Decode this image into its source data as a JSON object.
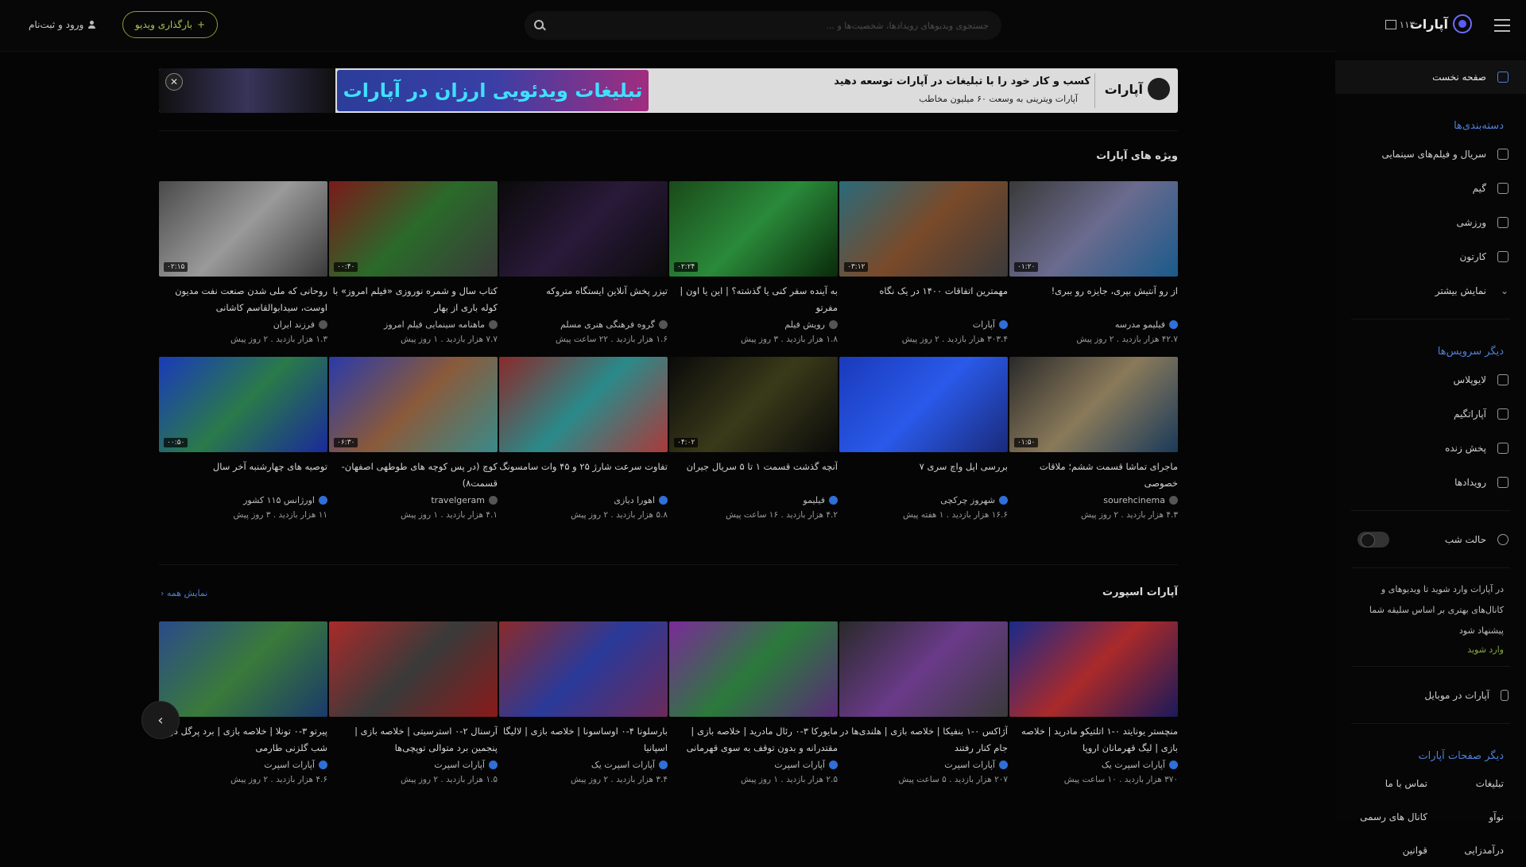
{
  "header": {
    "logo_text": "آپارات",
    "version_label": "۱۱۳",
    "search_placeholder": "جستجوی ویدیوهای رویدادها، شخصیت‌ها و ...",
    "upload_label": "بارگذاری ویدیو",
    "login_label": "ورود و ثبت‌نام"
  },
  "banner": {
    "headline": "کسب و کار خود را با تبلیغات در آپارات توسعه دهید",
    "subline": "آپارات ویترینی به وسعت ۶۰ میلیون مخاطب",
    "art_text": "تبلیغات ویدئویی ارزان در آپارات",
    "logo_text": "آپارات"
  },
  "sidebar": {
    "home": "صفحه نخست",
    "categories_title": "دسته‌بندی‌ها",
    "categories": [
      "سریال و فیلم‌های سینمایی",
      "گیم",
      "ورزشی",
      "کارتون",
      "نمایش بیشتر"
    ],
    "services_title": "دیگر سرویس‌ها",
    "services": [
      "لایوپلاس",
      "آپاراتگیم",
      "پخش زنده",
      "رویدادها"
    ],
    "night_mode": "حالت شب",
    "note": "در آپارات وارد شوید تا ویدیوهای و کانال‌های بهتری بر اساس سلیقه شما پیشنهاد شود",
    "login_link": "وارد شوید",
    "mobile": "آپارات در موبایل",
    "pages_title": "دیگر صفحات آپارات",
    "pages": [
      "تبلیغات",
      "تماس با ما",
      "نوآو",
      "کانال های رسمی",
      "درآمدزایی",
      "قوانین"
    ]
  },
  "featured": {
    "title": "ویژه های آپارات",
    "videos": [
      {
        "title": "از رو آنتیش بپری، جایزه رو ببری!",
        "channel": "فیلیمو مدرسه",
        "views": "۴۲.۷ هزار بازدید",
        "time": "۲ روز پیش",
        "dur": "۰۱:۲۰",
        "verified": true,
        "bg": "linear-gradient(135deg,#3a3a3a,#6b6b8f,#1a5a8a)"
      },
      {
        "title": "مهمترین اتفاقات ۱۴۰۰ در یک نگاه",
        "channel": "آپارات",
        "views": "۳۰۳.۴ هزار بازدید",
        "time": "۲ روز پیش",
        "dur": "۰۳:۱۲",
        "verified": true,
        "bg": "linear-gradient(135deg,#2a6a7a,#7a4a2a,#3a3a3a)"
      },
      {
        "title": "به آینده سفر کنی یا گذشته؟ | این یا اون | مفرتو",
        "channel": "رویش فیلم",
        "views": "۱.۸ هزار بازدید",
        "time": "۳ روز پیش",
        "dur": "۰۲:۲۴",
        "verified": false,
        "bg": "linear-gradient(135deg,#1a4a1a,#2a8a3a,#0a2a0a)"
      },
      {
        "title": "تیزر پخش آنلاین ایستگاه متروکه",
        "channel": "گروه فرهنگی هنری مسلم",
        "views": "۱.۶ هزار بازدید",
        "time": "۲۲ ساعت پیش",
        "dur": "",
        "verified": false,
        "bg": "linear-gradient(135deg,#0a0a0a,#2a1a3a,#0a0a0a)"
      },
      {
        "title": "کتاب سال و شمره نوروزی «فیلم امروز» با کوله باری از بهار",
        "channel": "ماهنامه سینمایی فیلم امروز",
        "views": "۷.۷ هزار بازدید",
        "time": "۱ روز پیش",
        "dur": "۰۰:۴۰",
        "verified": false,
        "bg": "linear-gradient(135deg,#7a1a1a,#2a6a2a,#3a3a3a)"
      },
      {
        "title": "روحانی که ملی شدن صنعت نفت مدیون اوست، سیدابوالقاسم کاشانی",
        "channel": "فرزند ایران",
        "views": "۱.۳ هزار بازدید",
        "time": "۲ روز پیش",
        "dur": "۰۲:۱۵",
        "verified": false,
        "bg": "linear-gradient(135deg,#4a4a4a,#9a9a9a,#3a3a3a)"
      },
      {
        "title": "ماجرای تماشا قسمت ششم؛ ملاقات خصوصی",
        "channel": "sourehcinema",
        "views": "۴.۳ هزار بازدید",
        "time": "۲ روز پیش",
        "dur": "۰۱:۵۰",
        "verified": false,
        "bg": "linear-gradient(135deg,#2a2a2a,#8a7a5a,#1a3a5a)"
      },
      {
        "title": "بررسی اپل واچ سری ۷",
        "channel": "شهروز چرکچی",
        "views": "۱۶.۶ هزار بازدید",
        "time": "۱ هفته پیش",
        "dur": "",
        "verified": true,
        "bg": "linear-gradient(135deg,#1a3aba,#2a5aea,#1a2a7a)"
      },
      {
        "title": "آنچه گذشت قسمت ۱ تا ۵ سریال جیران",
        "channel": "فیلیمو",
        "views": "۴.۲ هزار بازدید",
        "time": "۱۶ ساعت پیش",
        "dur": "۰۴:۰۲",
        "verified": true,
        "bg": "linear-gradient(135deg,#0a0a0a,#3a3a1a,#0a0a0a)"
      },
      {
        "title": "تفاوت سرعت شارژ ۲۵ و ۴۵ وات سامسونگ",
        "channel": "اهورا دیازی",
        "views": "۵.۸ هزار بازدید",
        "time": "۲ روز پیش",
        "dur": "",
        "verified": true,
        "bg": "linear-gradient(135deg,#8a2a2a,#2a8a8a,#aa3a3a)"
      },
      {
        "title": "کوچ (در پس کوچه های طوطهی اصفهان- قسمت۸)",
        "channel": "travelgeram",
        "views": "۴.۱ هزار بازدید",
        "time": "۱ روز پیش",
        "dur": "۰۶:۳۰",
        "verified": false,
        "bg": "linear-gradient(135deg,#2a3aaa,#8a5a3a,#3a8a8a)"
      },
      {
        "title": "توصیه های چهارشنبه آخر سال",
        "channel": "اورژانس ۱۱۵ کشور",
        "views": "۱۱ هزار بازدید",
        "time": "۳ روز پیش",
        "dur": "۰۰:۵۰",
        "verified": true,
        "bg": "linear-gradient(135deg,#1a3aba,#2a7a4a,#1a2a9a)"
      }
    ]
  },
  "sport": {
    "title": "آپارات اسپورت",
    "more": "نمایش همه",
    "videos": [
      {
        "title": "منچستر یونایتد ۰-۱ اتلتیکو مادرید | خلاصه بازی | لیگ قهرمانان اروپا",
        "channel": "آپارات اسپرت یک",
        "views": "۳۷۰ هزار بازدید",
        "time": "۱۰ ساعت پیش",
        "dur": "",
        "verified": true,
        "bg": "linear-gradient(135deg,#1a2a8a,#aa2a2a,#1a1a5a)"
      },
      {
        "title": "آژاکس ۰-۱ بنفیکا | خلاصه بازی | هلندی‌ها در جام کنار رفتند",
        "channel": "آپارات اسپرت",
        "views": "۲۰۷ هزار بازدید",
        "time": "۵ ساعت پیش",
        "dur": "",
        "verified": true,
        "bg": "linear-gradient(135deg,#2a2a2a,#6a3a8a,#3a3a3a)"
      },
      {
        "title": "مایورکا ۳-۰ رئال مادرید | خلاصه بازی | مقتدرانه و بدون توقف به سوی قهرمانی",
        "channel": "آپارات اسپرت",
        "views": "۲.۵ هزار بازدید",
        "time": "۱ روز پیش",
        "dur": "",
        "verified": true,
        "bg": "linear-gradient(135deg,#7a2a9a,#2a7a3a,#5a2a7a)"
      },
      {
        "title": "بارسلونا ۴-۰ اوساسونا | خلاصه بازی | لالیگا اسپانیا",
        "channel": "آپارات اسپرت یک",
        "views": "۳.۴ هزار بازدید",
        "time": "۲ روز پیش",
        "dur": "",
        "verified": true,
        "bg": "linear-gradient(135deg,#8a2a2a,#2a3a9a,#6a2a5a)"
      },
      {
        "title": "آرسنال ۲-۰ استرسیتی | خلاصه بازی | پنجمین برد متوالی توپچی‌ها",
        "channel": "آپارات اسپرت",
        "views": "۱.۵ هزار بازدید",
        "time": "۲ روز پیش",
        "dur": "",
        "verified": true,
        "bg": "linear-gradient(135deg,#aa2a2a,#3a3a3a,#8a1a1a)"
      },
      {
        "title": "پیرتو ۳-۰ تونلا | خلاصه بازی | برد پرگل در شب گلزنی طارمی",
        "channel": "آپارات اسپرت",
        "views": "۴.۶ هزار بازدید",
        "time": "۲ روز پیش",
        "dur": "",
        "verified": true,
        "bg": "linear-gradient(135deg,#2a4a8a,#3a7a3a,#1a3a6a)"
      }
    ]
  },
  "colors": {
    "accent": "#86a83e",
    "link": "#4f7fd8",
    "bg": "#050505"
  }
}
